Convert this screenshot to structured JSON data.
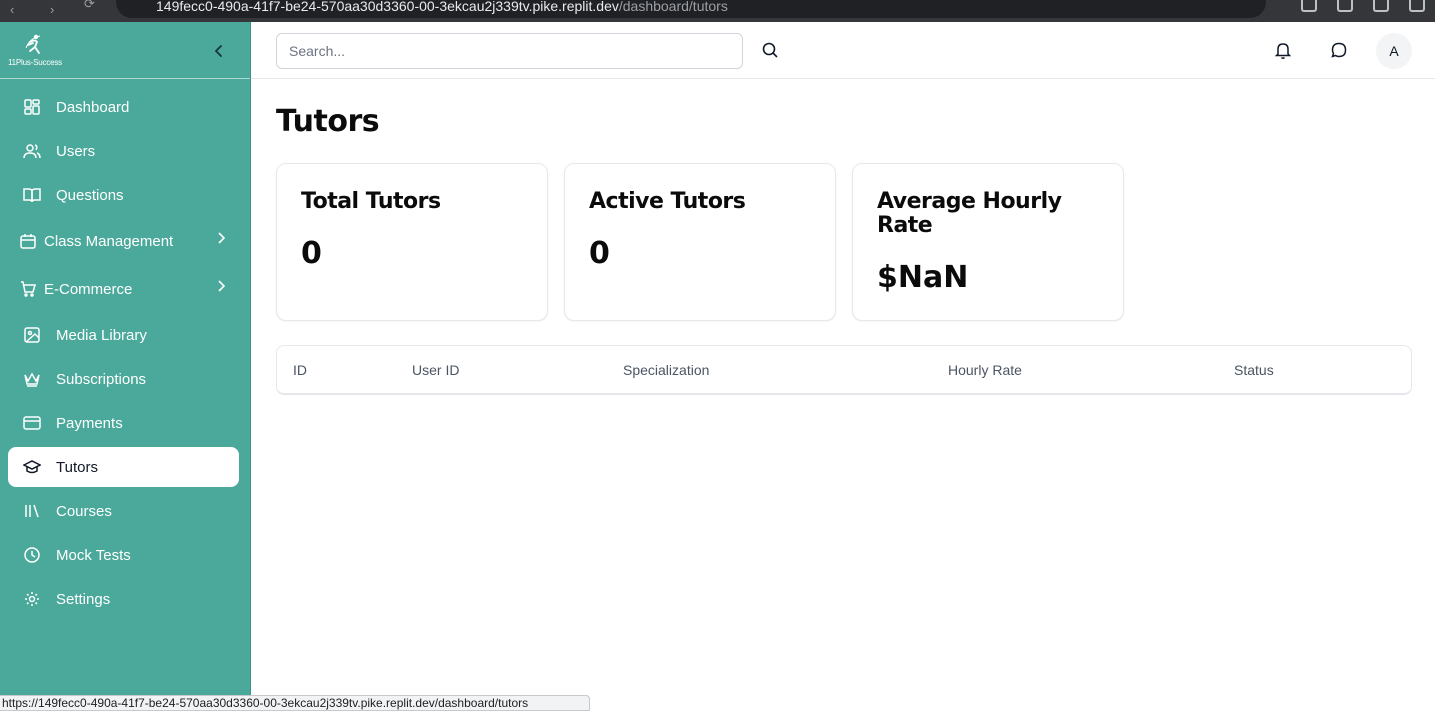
{
  "browser": {
    "url_main": "149fecc0-490a-41f7-be24-570aa30d3360-00-3ekcau2j339tv.pike.replit.dev",
    "url_path": "/dashboard/tutors",
    "status_url": "https://149fecc0-490a-41f7-be24-570aa30d3360-00-3ekcau2j339tv.pike.replit.dev/dashboard/tutors"
  },
  "brand": {
    "logo_text": "11Plus-Success"
  },
  "sidebar": {
    "items": [
      {
        "label": "Dashboard",
        "icon": "dashboard-icon"
      },
      {
        "label": "Users",
        "icon": "users-icon"
      },
      {
        "label": "Questions",
        "icon": "book-icon"
      },
      {
        "label": "Class Management",
        "icon": "calendar-icon",
        "expandable": true
      },
      {
        "label": "E-Commerce",
        "icon": "cart-icon",
        "expandable": true
      },
      {
        "label": "Media Library",
        "icon": "image-icon"
      },
      {
        "label": "Subscriptions",
        "icon": "crown-icon"
      },
      {
        "label": "Payments",
        "icon": "credit-card-icon"
      },
      {
        "label": "Tutors",
        "icon": "graduation-cap-icon",
        "active": true
      },
      {
        "label": "Courses",
        "icon": "library-icon"
      },
      {
        "label": "Mock Tests",
        "icon": "clock-icon"
      },
      {
        "label": "Settings",
        "icon": "gear-icon"
      }
    ]
  },
  "header": {
    "search_placeholder": "Search...",
    "avatar_initial": "A"
  },
  "main": {
    "title": "Tutors",
    "cards": [
      {
        "title": "Total Tutors",
        "value": "0"
      },
      {
        "title": "Active Tutors",
        "value": "0"
      },
      {
        "title": "Average Hourly Rate",
        "value": "$NaN"
      }
    ],
    "table": {
      "columns": [
        "ID",
        "User ID",
        "Specialization",
        "Hourly Rate",
        "Status"
      ],
      "rows": []
    }
  },
  "colors": {
    "sidebar_bg": "#4aa99a",
    "active_item_bg": "#ffffff"
  }
}
